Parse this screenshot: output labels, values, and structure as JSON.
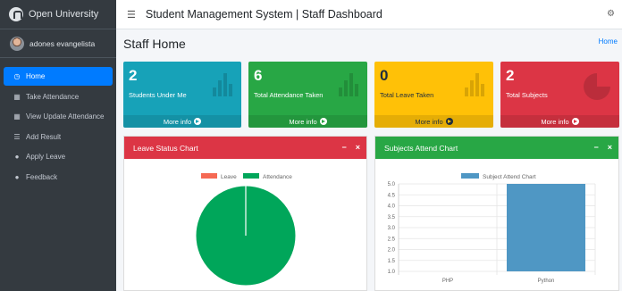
{
  "brand": {
    "name": "Open University"
  },
  "user": {
    "name": "adones evangelista"
  },
  "nav": {
    "items": [
      {
        "label": "Home",
        "icon": "dashboard-icon"
      },
      {
        "label": "Take Attendance",
        "icon": "calendar-icon"
      },
      {
        "label": "View Update Attendance",
        "icon": "calendar-icon"
      },
      {
        "label": "Add Result",
        "icon": "list-icon"
      },
      {
        "label": "Apply Leave",
        "icon": "chat-icon"
      },
      {
        "label": "Feedback",
        "icon": "comments-icon"
      }
    ]
  },
  "header": {
    "title": "Student Management System | Staff Dashboard"
  },
  "page": {
    "title": "Staff Home",
    "breadcrumb": "Home"
  },
  "stats": [
    {
      "value": "2",
      "label": "Students Under Me",
      "footer": "More info",
      "color": "#17a2b8"
    },
    {
      "value": "6",
      "label": "Total Attendance Taken",
      "footer": "More info",
      "color": "#28a745"
    },
    {
      "value": "0",
      "label": "Total Leave Taken",
      "footer": "More info",
      "color": "#ffc107"
    },
    {
      "value": "2",
      "label": "Total Subjects",
      "footer": "More info",
      "color": "#dc3545"
    }
  ],
  "leave_card": {
    "title": "Leave Status Chart",
    "color": "#dc3545"
  },
  "subjects_card": {
    "title": "Subjects Attend Chart",
    "color": "#28a745"
  },
  "chart_data": [
    {
      "type": "pie",
      "legend": [
        "Leave",
        "Attendance"
      ],
      "values": [
        0,
        6
      ],
      "colors": [
        "#f56954",
        "#00a65a"
      ]
    },
    {
      "type": "bar",
      "legend": [
        "Subject Attend Chart"
      ],
      "categories": [
        "PHP",
        "Python"
      ],
      "values": [
        0,
        5
      ],
      "ylim": [
        1.0,
        5.0
      ],
      "yticks": [
        "5.0",
        "4.5",
        "4.0",
        "3.5",
        "3.0",
        "2.5",
        "2.0",
        "1.5",
        "1.0"
      ],
      "color": "#4f97c4"
    }
  ]
}
